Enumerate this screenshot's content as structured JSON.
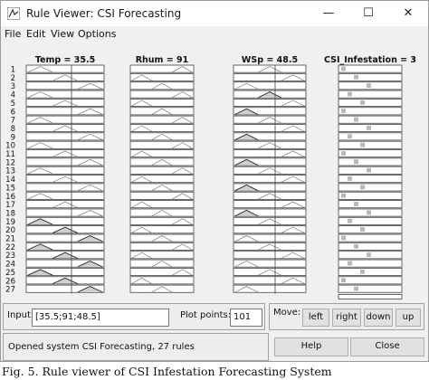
{
  "window": {
    "title": "Rule Viewer: CSI Forecasting",
    "controls": {
      "minimize": "—",
      "maximize": "☐",
      "close": "✕"
    }
  },
  "menu": [
    "File",
    "Edit",
    "View",
    "Options"
  ],
  "variables": [
    {
      "title": "Temp = 35.5"
    },
    {
      "title": "Rhum = 91"
    },
    {
      "title": "WSp = 48.5"
    },
    {
      "title": "CSI_Infestation = 3"
    }
  ],
  "rules": [
    "1",
    "2",
    "3",
    "4",
    "5",
    "6",
    "7",
    "8",
    "9",
    "10",
    "11",
    "12",
    "13",
    "14",
    "15",
    "16",
    "17",
    "18",
    "19",
    "20",
    "21",
    "22",
    "23",
    "24",
    "25",
    "26",
    "27"
  ],
  "input": {
    "label": "Input:",
    "value": "[35.5;91;48.5]"
  },
  "plot_points": {
    "label": "Plot points:",
    "value": "101"
  },
  "move": {
    "label": "Move:",
    "buttons": [
      "left",
      "right",
      "down",
      "up"
    ]
  },
  "status": "Opened system CSI Forecasting, 27 rules",
  "actions": {
    "help": "Help",
    "close": "Close"
  },
  "caption": "Fig. 5. Rule viewer of CSI Infestation Forecasting System"
}
